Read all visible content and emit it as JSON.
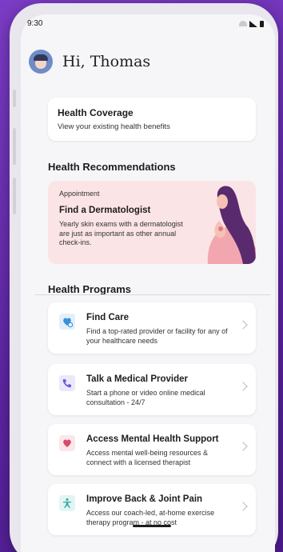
{
  "status_bar": {
    "time": "9:30"
  },
  "greeting": {
    "text": "Hi, Thomas"
  },
  "health_coverage": {
    "title": "Health Coverage",
    "subtitle": "View your existing health benefits"
  },
  "recommendations": {
    "section_title": "Health Recommendations",
    "card": {
      "tag": "Appointment",
      "title": "Find a Dermatologist",
      "body": "Yearly skin exams with a dermatologist are just as important as other annual check-ins."
    }
  },
  "programs": {
    "section_title": "Health Programs",
    "items": [
      {
        "title": "Find Care",
        "subtitle": "Find a top-rated provider or facility for any of your healthcare needs",
        "icon": "find-care-icon",
        "icon_color": "#3a8fd8",
        "icon_bg": "#e3effb"
      },
      {
        "title": "Talk a Medical Provider",
        "subtitle": "Start a phone or video online medical consultation - 24/7",
        "icon": "phone-icon",
        "icon_color": "#6b5bd6",
        "icon_bg": "#ebe8fb"
      },
      {
        "title": "Access Mental Health Support",
        "subtitle": "Access mental well-being resources & connect with a licensed therapist",
        "icon": "heart-icon",
        "icon_color": "#d94a6a",
        "icon_bg": "#fbe6ea"
      },
      {
        "title": "Improve Back & Joint Pain",
        "subtitle": "Access our coach-led, at-home exercise therapy program - at no cost",
        "icon": "exercise-icon",
        "icon_color": "#2aa79b",
        "icon_bg": "#e2f5f2"
      }
    ]
  },
  "colors": {
    "background": "#6a2fb0",
    "reco_card": "#fbe4e6"
  }
}
